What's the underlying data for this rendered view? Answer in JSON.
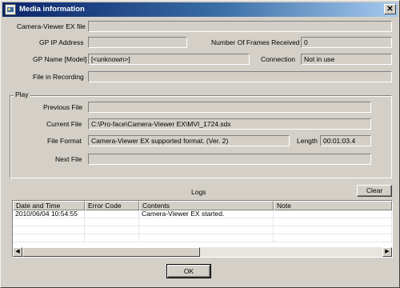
{
  "window": {
    "title": "Media information",
    "close_glyph": "✕"
  },
  "info": {
    "camera_viewer_ex_file": {
      "label": "Camera-Viewer EX file",
      "value": ""
    },
    "gp_ip_address": {
      "label": "GP IP Address",
      "value": ""
    },
    "frames_received": {
      "label": "Number Of Frames Received",
      "value": "0"
    },
    "gp_name": {
      "label": "GP Name [Model]",
      "value": "[<unknown>]"
    },
    "connection": {
      "label": "Connection",
      "value": "Not in use"
    },
    "file_in_recording": {
      "label": "File in Recording",
      "value": ""
    }
  },
  "play": {
    "group_label": "Play",
    "previous_file": {
      "label": "Previous File",
      "value": ""
    },
    "current_file": {
      "label": "Current File",
      "value": "C:\\Pro-face\\Camera-Viewer EX\\MVI_1724.sdx"
    },
    "file_format": {
      "label": "File Format",
      "value": "Camera-Viewer EX supported format. (Ver. 2)"
    },
    "length": {
      "label": "Length",
      "value": "00:01:03.4"
    },
    "next_file": {
      "label": "Next File",
      "value": ""
    }
  },
  "logs": {
    "title": "Logs",
    "clear_label": "Clear",
    "columns": [
      "Date and Time",
      "Error Code",
      "Contents",
      "Note"
    ],
    "rows": [
      [
        "2010/06/04 10:54:55",
        "",
        "Camera-Viewer EX started.",
        ""
      ]
    ],
    "scroll_left_glyph": "◀",
    "scroll_right_glyph": "▶"
  },
  "ok_label": "OK"
}
